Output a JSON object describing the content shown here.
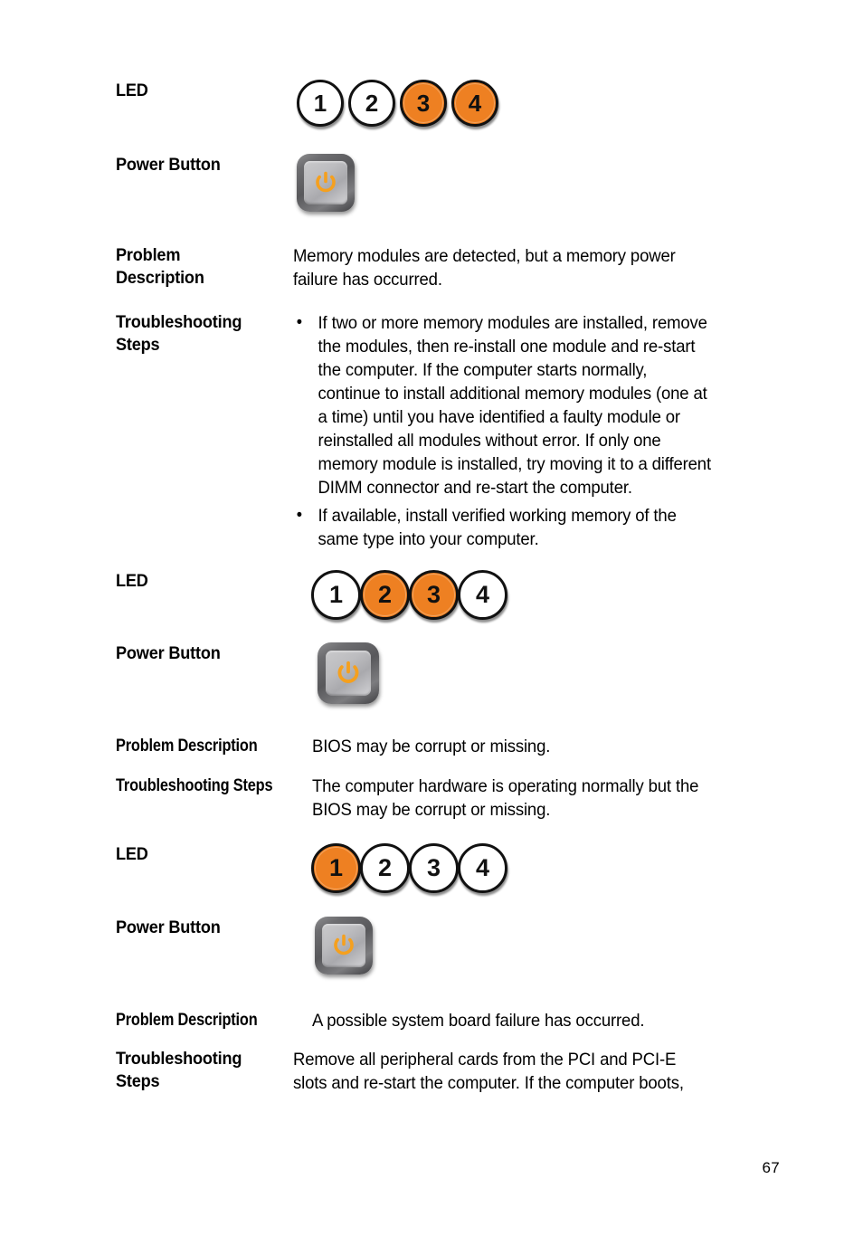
{
  "page": {
    "number": "67",
    "accent_orange": "#ee8022",
    "text_color": "#000000",
    "background": "#ffffff"
  },
  "labels": {
    "led": "LED",
    "power_button": "Power Button",
    "problem_description": "Problem Description",
    "problem_description_wrapped": "Problem\nDescription",
    "troubleshooting_steps": "Troubleshooting Steps",
    "troubleshooting_steps_wrapped": "Troubleshooting\nSteps"
  },
  "sections": [
    {
      "led_states": [
        {
          "number": "1",
          "on": false
        },
        {
          "number": "2",
          "on": false
        },
        {
          "number": "3",
          "on": true
        },
        {
          "number": "4",
          "on": true
        }
      ],
      "power_button_state": "on",
      "problem_description": "Memory modules are detected, but a memory power\nfailure has occurred.",
      "troubleshooting_bullets": [
        "If two or more memory modules are installed, remove\nthe modules, then re-install one module and re-start\nthe computer. If the computer starts normally,\ncontinue to install additional memory modules (one at\na time) until you have identified a faulty module or\nreinstalled all modules without error. If only one\nmemory module is installed, try moving it to a different\nDIMM connector and re-start the computer.",
        "If available, install verified working memory of the\nsame type into your computer."
      ]
    },
    {
      "led_states": [
        {
          "number": "1",
          "on": false
        },
        {
          "number": "2",
          "on": true
        },
        {
          "number": "3",
          "on": true
        },
        {
          "number": "4",
          "on": false
        }
      ],
      "power_button_state": "on",
      "problem_description": "BIOS may be corrupt or missing.",
      "troubleshooting_text": "The computer hardware is operating normally but the\nBIOS may be corrupt or missing."
    },
    {
      "led_states": [
        {
          "number": "1",
          "on": true
        },
        {
          "number": "2",
          "on": false
        },
        {
          "number": "3",
          "on": false
        },
        {
          "number": "4",
          "on": false
        }
      ],
      "power_button_state": "on",
      "problem_description": "A possible system board failure has occurred.",
      "troubleshooting_text": "Remove all peripheral cards from the PCI and PCI-E\nslots and re-start the computer. If the computer boots,"
    }
  ],
  "icons": {
    "led": "led-indicator-icon",
    "power": "power-symbol-icon",
    "bullet": "•"
  }
}
